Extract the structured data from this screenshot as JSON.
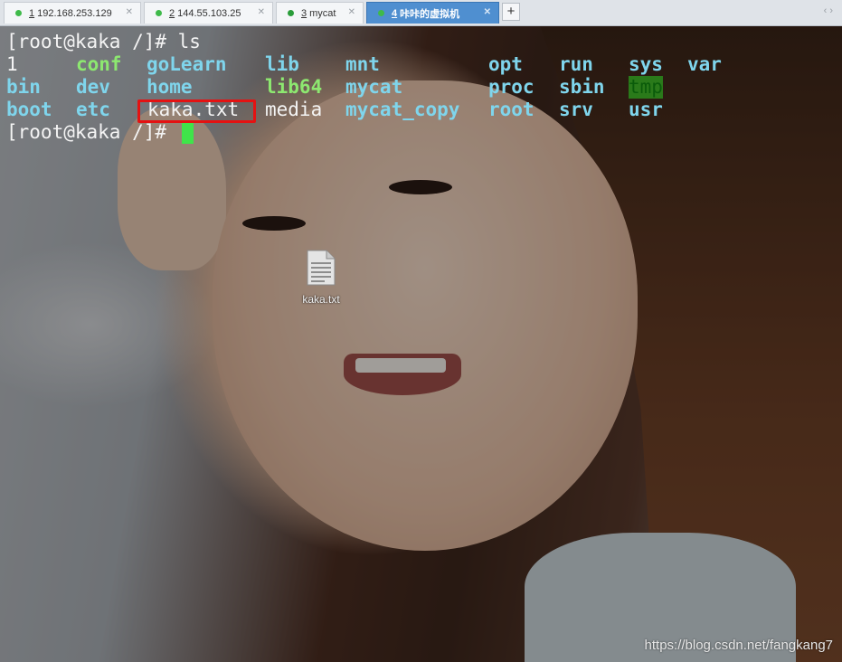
{
  "tabs": [
    {
      "num": "1",
      "label": "192.168.253.129",
      "dot": "#3fba4a",
      "active": false
    },
    {
      "num": "2",
      "label": "144.55.103.25",
      "dot": "#3fba4a",
      "active": false
    },
    {
      "num": "3",
      "label": "mycat",
      "dot": "#2a9d3a",
      "active": false
    },
    {
      "num": "4",
      "label": "咔咔的虚拟机",
      "dot": "#3fba4a",
      "active": true
    }
  ],
  "add_tab_label": "+",
  "nav_arrows": "‹ ›",
  "terminal": {
    "prompt1": "[root@kaka /]# ls",
    "prompt2": "[root@kaka /]# ",
    "listing": {
      "row1": [
        "1",
        "conf",
        "goLearn",
        "lib",
        "mnt",
        "opt",
        "run",
        "sys",
        "var"
      ],
      "row2": [
        "bin",
        "dev",
        "home",
        "lib64",
        "mycat",
        "proc",
        "sbin",
        "tmp"
      ],
      "row3": [
        "boot",
        "etc",
        "kaka.txt",
        "media",
        "mycat_copy",
        "root",
        "srv",
        "usr"
      ]
    }
  },
  "desktop_icon": {
    "label": "kaka.txt",
    "icon": "text-file-icon"
  },
  "watermark": "https://blog.csdn.net/fangkang7",
  "colors": {
    "highlight_box": "#e41212",
    "cursor": "#3fe44a",
    "tab_active": "#4f8fd0"
  }
}
